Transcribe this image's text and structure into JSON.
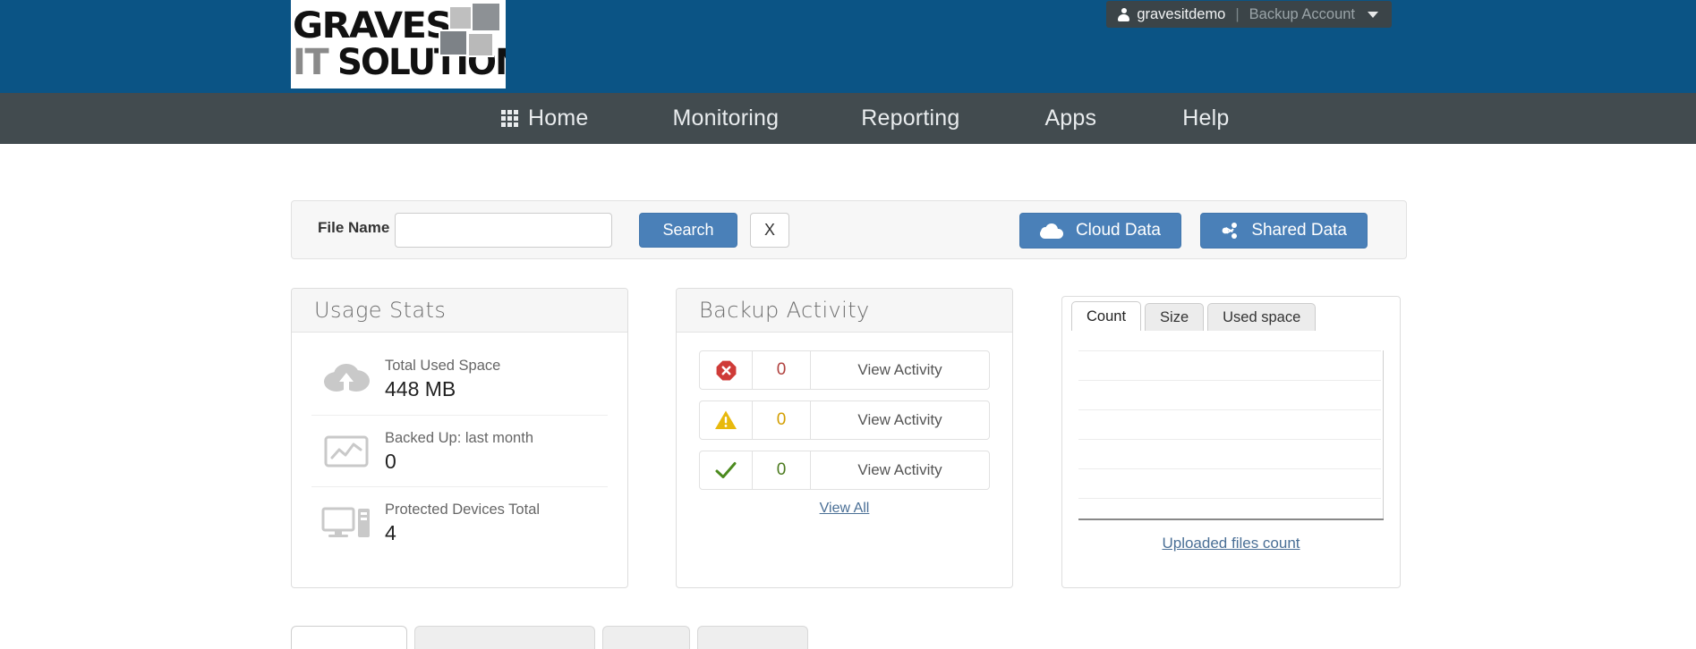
{
  "header": {
    "logo": {
      "line1": "GRAVES",
      "line2_it": "IT",
      "line2_solutions": "SOLUTIONS",
      "alt": "Graves IT Solutions"
    },
    "user": {
      "icon": "person-icon",
      "username": "gravesitdemo",
      "separator": "|",
      "role": "Backup Account",
      "caret": "chevron-down-icon"
    },
    "background_color": "#0b5485"
  },
  "nav": {
    "background_color": "#424b4f",
    "items": [
      {
        "label": "Home",
        "icon": "grid-icon",
        "active": true
      },
      {
        "label": "Monitoring",
        "icon": "",
        "active": false
      },
      {
        "label": "Reporting",
        "icon": "",
        "active": false
      },
      {
        "label": "Apps",
        "icon": "",
        "active": false
      },
      {
        "label": "Help",
        "icon": "",
        "active": false
      }
    ]
  },
  "search": {
    "label": "File Name",
    "value": "",
    "placeholder": "",
    "search_label": "Search",
    "clear_label": "X",
    "cloud_data_label": "Cloud Data",
    "cloud_icon": "cloud-icon",
    "shared_data_label": "Shared Data",
    "shared_icon": "share-icon",
    "button_color": "#4a80b8"
  },
  "usage_stats": {
    "title": "Usage Stats",
    "rows": [
      {
        "icon": "cloud-upload-icon",
        "label": "Total Used Space",
        "value": "448 MB"
      },
      {
        "icon": "line-chart-icon",
        "label": "Backed Up: last month",
        "value": "0"
      },
      {
        "icon": "desktop-computer-icon",
        "label": "Protected Devices Total",
        "value": "4"
      }
    ]
  },
  "backup_activity": {
    "title": "Backup Activity",
    "rows": [
      {
        "icon": "error-octagon-icon",
        "status": "error",
        "count": "0",
        "link": "View Activity",
        "color": "#b0413e"
      },
      {
        "icon": "warning-triangle-icon",
        "status": "warning",
        "count": "0",
        "link": "View Activity",
        "color": "#d39e00"
      },
      {
        "icon": "success-check-icon",
        "status": "success",
        "count": "0",
        "link": "View Activity",
        "color": "#4b7a1e"
      }
    ],
    "view_all": "View All"
  },
  "chart_panel": {
    "tabs": [
      {
        "label": "Count",
        "active": true
      },
      {
        "label": "Size",
        "active": false
      },
      {
        "label": "Used space",
        "active": false
      }
    ],
    "caption": "Uploaded files count"
  },
  "chart_data": {
    "type": "bar",
    "title": "Uploaded files count",
    "categories": [],
    "values": [],
    "xlabel": "",
    "ylabel": "",
    "gridlines": 6,
    "grid": true,
    "legend": "none",
    "note": "empty chart - no data plotted"
  },
  "bottom_tabs": [
    {
      "label": "",
      "active": true
    },
    {
      "label": "",
      "active": false
    },
    {
      "label": "",
      "active": false
    },
    {
      "label": "",
      "active": false
    }
  ]
}
